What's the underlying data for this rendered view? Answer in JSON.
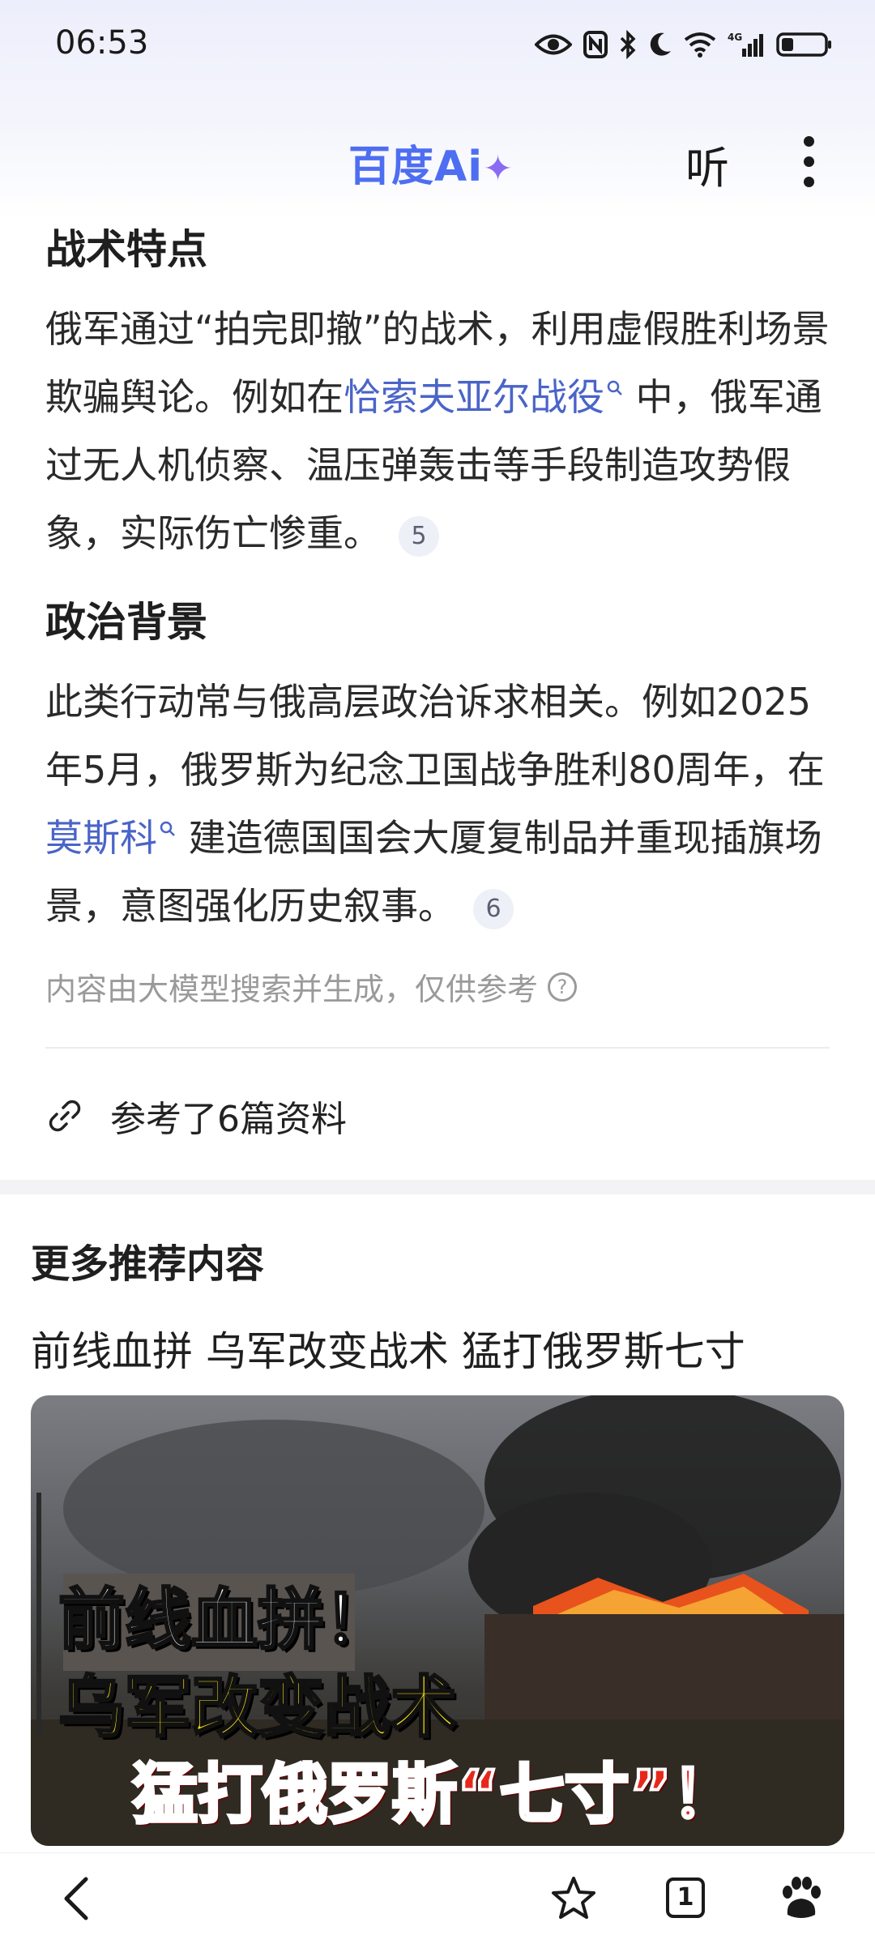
{
  "status_bar": {
    "time": "06:53",
    "network": "4G"
  },
  "header": {
    "brand": "百度",
    "brand_suffix": "Ai",
    "brand_star": "✦",
    "listen_label": "听"
  },
  "section1": {
    "title": "战术特点",
    "text_before": "俄军通过“拍完即撤”的战术，利用虚假胜利场景欺骗舆论。例如在",
    "link": "恰索夫亚尔战役",
    "text_after": " 中，俄军通过无人机侦察、温压弹轰击等手段制造攻势假象，实际伤亡惨重。",
    "citation": "5"
  },
  "section2": {
    "title": "政治背景",
    "text_before": "此类行动常与俄高层政治诉求相关。例如2025年5月，俄罗斯为纪念卫国战争胜利80周年，在",
    "link": "莫斯科",
    "text_after": " 建造德国国会大厦复制品并重现插旗场景，意图强化历史叙事。",
    "citation": "6"
  },
  "disclaimer": "内容由大模型搜索并生成，仅供参考",
  "references": "参考了6篇资料",
  "recommend": {
    "section_title": "更多推荐内容",
    "item_title": "前线血拼 乌军改变战术 猛打俄罗斯七寸",
    "image_caption_line1": "前线血拼！",
    "image_caption_line2": "乌军改变战术",
    "image_caption_line3": "猛打俄罗斯“七寸”！"
  },
  "bottom_nav": {
    "tab_count": "1"
  }
}
